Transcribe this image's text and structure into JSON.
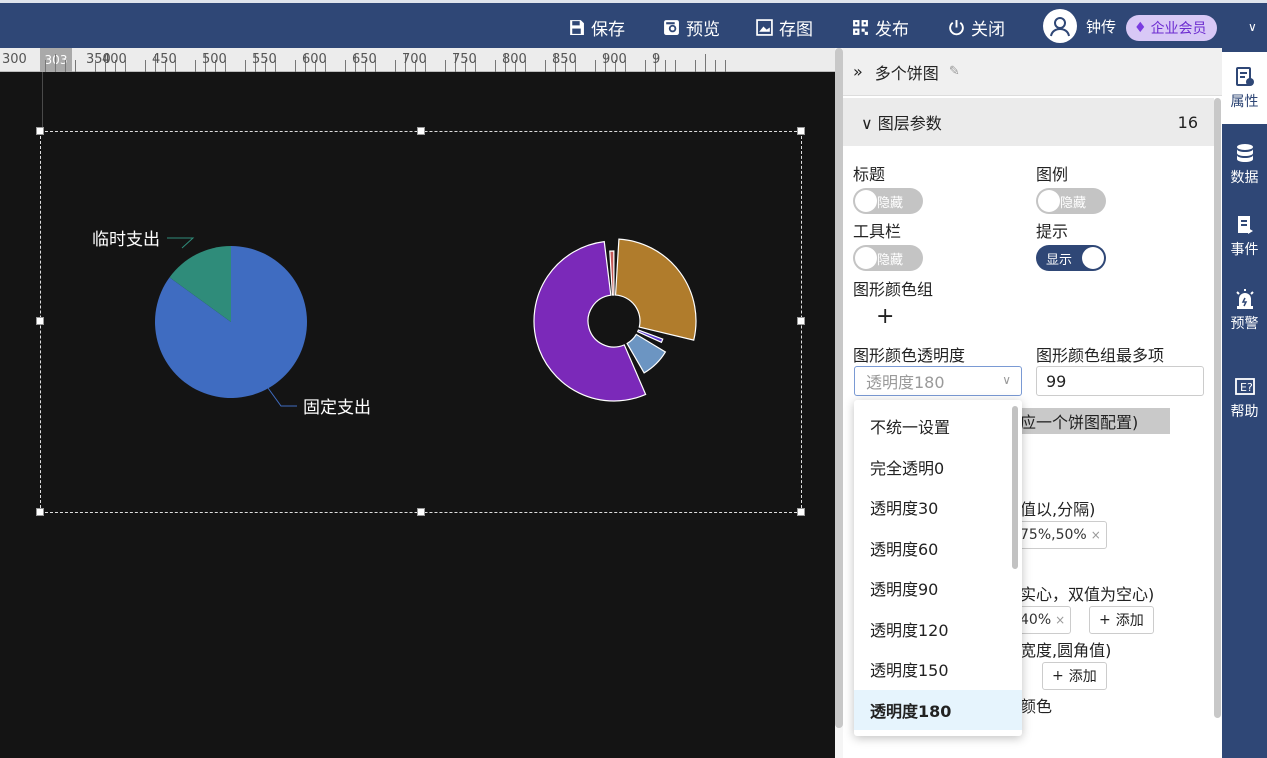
{
  "toolbar": {
    "save": "保存",
    "preview": "预览",
    "save_image": "存图",
    "publish": "发布",
    "close": "关闭",
    "username": "钟传",
    "membership": "企业会员"
  },
  "ruler": {
    "labels": [
      "300",
      "350",
      "400",
      "450",
      "500",
      "550",
      "600",
      "650",
      "700",
      "750",
      "800",
      "850",
      "900",
      "9"
    ],
    "marker": "303"
  },
  "chart_data": [
    {
      "type": "pie",
      "labels": [
        "固定支出",
        "临时支出"
      ],
      "values": [
        85,
        15
      ],
      "colors": [
        "#3f6cc1",
        "#2f8c7a"
      ]
    },
    {
      "type": "pie",
      "description_rose": true,
      "values": [
        30,
        3,
        10,
        57,
        1
      ],
      "colors": [
        "#b07c2c",
        "#5d3bd1",
        "#6c95c2",
        "#7b29b9",
        "#c45a5a"
      ]
    }
  ],
  "panel": {
    "title": "多个饼图",
    "section": {
      "label": "图层参数",
      "count": "16"
    },
    "title_label": "标题",
    "title_toggle": "隐藏",
    "legend_label": "图例",
    "legend_toggle": "隐藏",
    "toolbar_label": "工具栏",
    "toolbar_toggle": "隐藏",
    "tip_label": "提示",
    "tip_toggle": "显示",
    "color_group_label": "图形颜色组",
    "opacity_label": "图形颜色透明度",
    "opacity_value": "透明度180",
    "max_colors_label": "图形颜色组最多项",
    "max_colors_value": "99",
    "fragment_pie_config": "应一个饼图配置)",
    "fragment_center": "值以,分隔)",
    "tag_center": "75%,50%",
    "fragment_radius": "实心，双值为空心)",
    "tag_radius": "40%",
    "add_label": "添加",
    "fragment_border": "宽度,圆角值)",
    "fragment_color": "颜色"
  },
  "dropdown": {
    "options": [
      "不统一设置",
      "完全透明0",
      "透明度30",
      "透明度60",
      "透明度90",
      "透明度120",
      "透明度150",
      "透明度180"
    ],
    "selected_index": 7
  },
  "sidenav": {
    "items": [
      "属性",
      "数据",
      "事件",
      "预警",
      "帮助"
    ],
    "active_index": 0
  }
}
